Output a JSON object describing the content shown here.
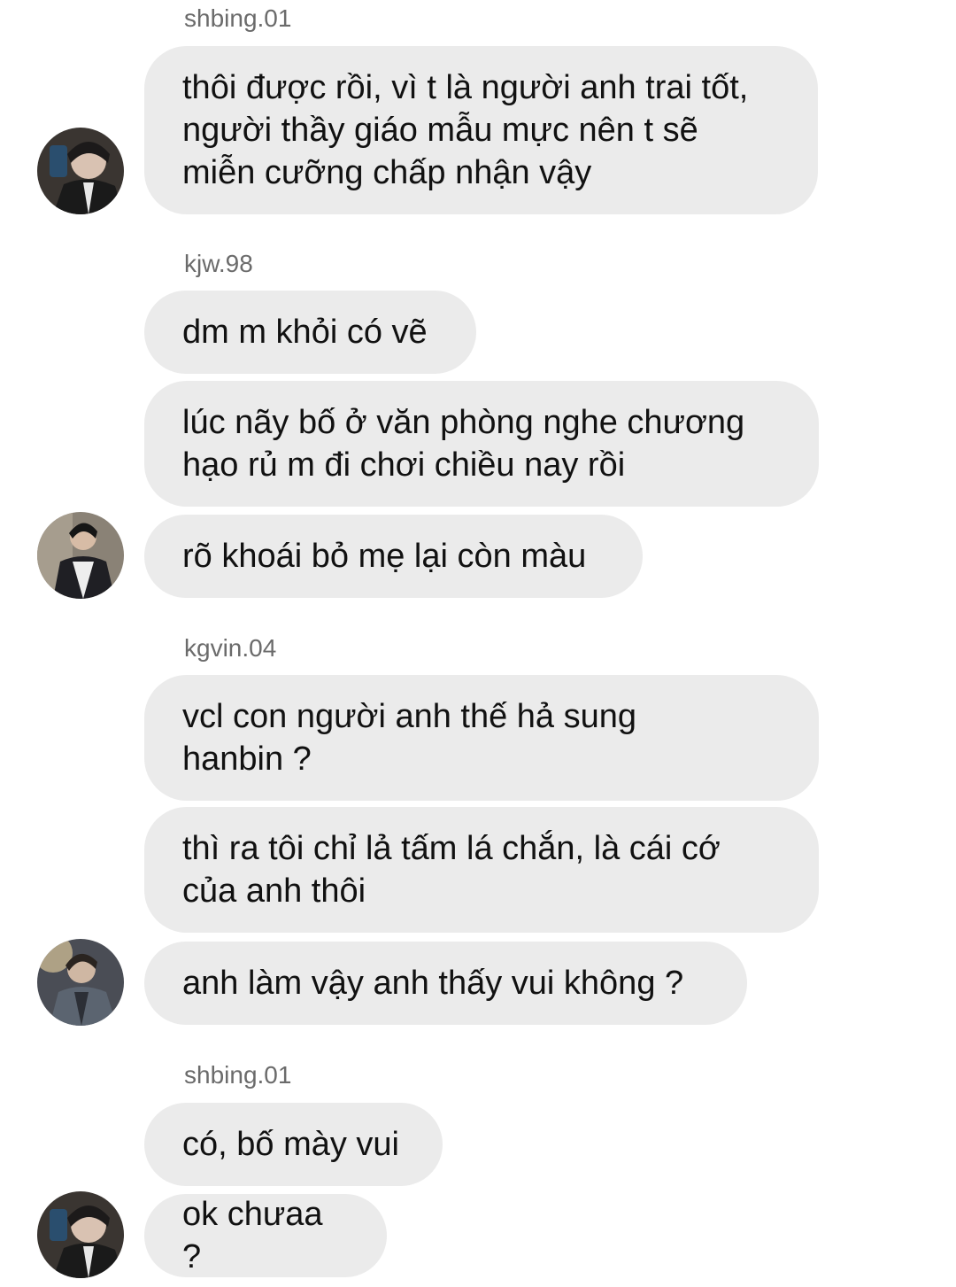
{
  "groups": [
    {
      "sender": "shbing.01",
      "messages": [
        "thôi được rồi, vì t là người anh trai tốt,\nngười thầy giáo mẫu mực nên t sẽ\nmiễn cưỡng chấp nhận vậy"
      ],
      "avatar": "avatar-photo-shbing"
    },
    {
      "sender": "kjw.98",
      "messages": [
        "dm m khỏi có vẽ",
        "lúc nãy bố ở văn phòng nghe chương\nhạo rủ m đi chơi chiều nay rồi",
        "rõ khoái bỏ mẹ lại còn màu"
      ],
      "avatar": "avatar-photo-kjw"
    },
    {
      "sender": "kgvin.04",
      "messages": [
        "vcl con người anh thế hả sung\nhanbin ?",
        "thì ra tôi chỉ lả tấm lá chắn, là cái cớ\ncủa anh thôi",
        "anh làm vậy anh thấy vui không ?"
      ],
      "avatar": "avatar-photo-kgvin"
    },
    {
      "sender": "shbing.01",
      "messages": [
        "có, bố mày vui",
        "ok chưaa ?"
      ],
      "avatar": "avatar-photo-shbing"
    }
  ],
  "colors": {
    "bubble": "#ebebeb",
    "sender_text": "#6b6b6b",
    "message_text": "#111111",
    "background": "#ffffff"
  }
}
